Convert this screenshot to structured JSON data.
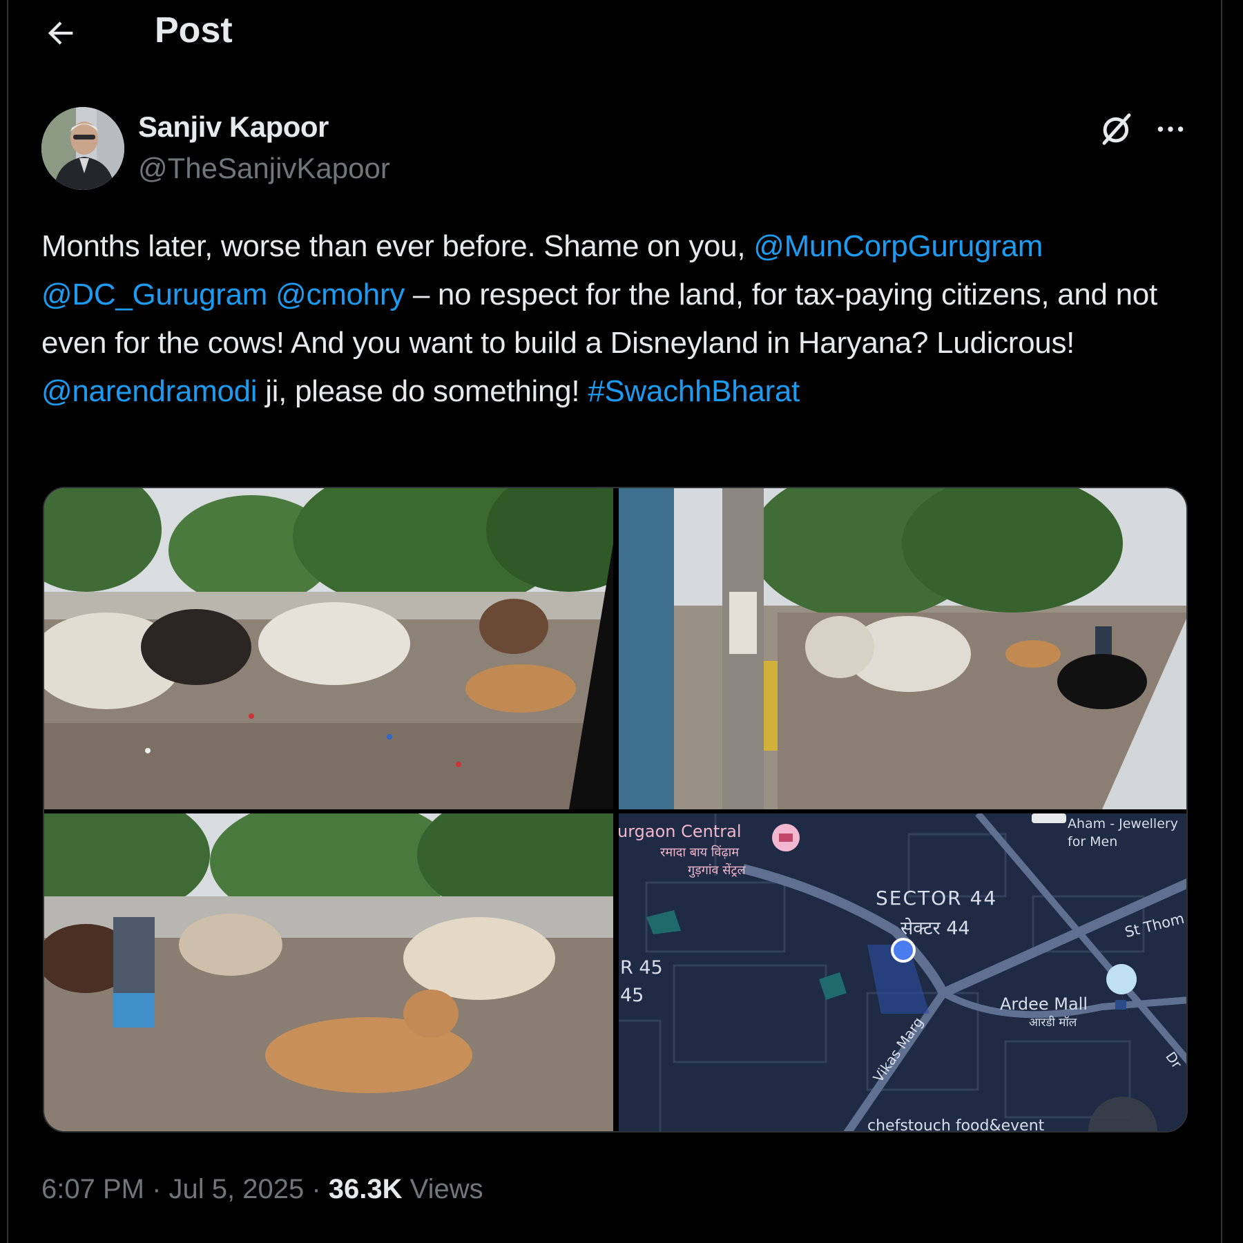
{
  "header": {
    "title": "Post"
  },
  "author": {
    "name": "Sanjiv Kapoor",
    "handle": "@TheSanjivKapoor"
  },
  "post": {
    "segments": [
      {
        "text": "Months later, worse than ever before. Shame on you, ",
        "type": "text"
      },
      {
        "text": "@MunCorpGurugram",
        "type": "mention"
      },
      {
        "text": " ",
        "type": "text"
      },
      {
        "text": "@DC_Gurugram",
        "type": "mention"
      },
      {
        "text": " ",
        "type": "text"
      },
      {
        "text": "@cmohry",
        "type": "mention"
      },
      {
        "text": " – no respect for the land, for tax-paying citizens, and not even for the cows! And you want to build a Disneyland in Haryana? Ludicrous! ",
        "type": "text"
      },
      {
        "text": "@narendramodi",
        "type": "mention"
      },
      {
        "text": " ji, please do something! ",
        "type": "text"
      },
      {
        "text": "#SwachhBharat",
        "type": "hashtag"
      }
    ]
  },
  "map": {
    "place1_en": "urgaon Central",
    "place1_hi_a": "रमादा बाय विंढ़ाम",
    "place1_hi_b": "गुड़गांव सेंट्रल",
    "place2_en": "Aham - Jewellery",
    "place2_en_b": "for Men",
    "sector_en": "SECTOR 44",
    "sector_hi": "सेक्टर 44",
    "sector45_a": "R 45",
    "sector45_b": "45",
    "road1": "St Thom",
    "mall_en": "Ardee Mall",
    "mall_hi": "आरडी मॉल",
    "road2": "Vikas Marg",
    "road3": "Dr",
    "bottom": "chefstouch food&event"
  },
  "meta": {
    "time": "6:07 PM",
    "sep1": " · ",
    "date": "Jul 5, 2025",
    "sep2": " · ",
    "views_count": "36.3K",
    "views_label": " Views"
  },
  "colors": {
    "accent": "#1d9bf0",
    "muted": "#71767b",
    "text": "#e7e9ea",
    "background": "#000000"
  },
  "icons": {
    "back": "arrow-left-icon",
    "grok": "grok-icon",
    "more": "more-icon"
  }
}
